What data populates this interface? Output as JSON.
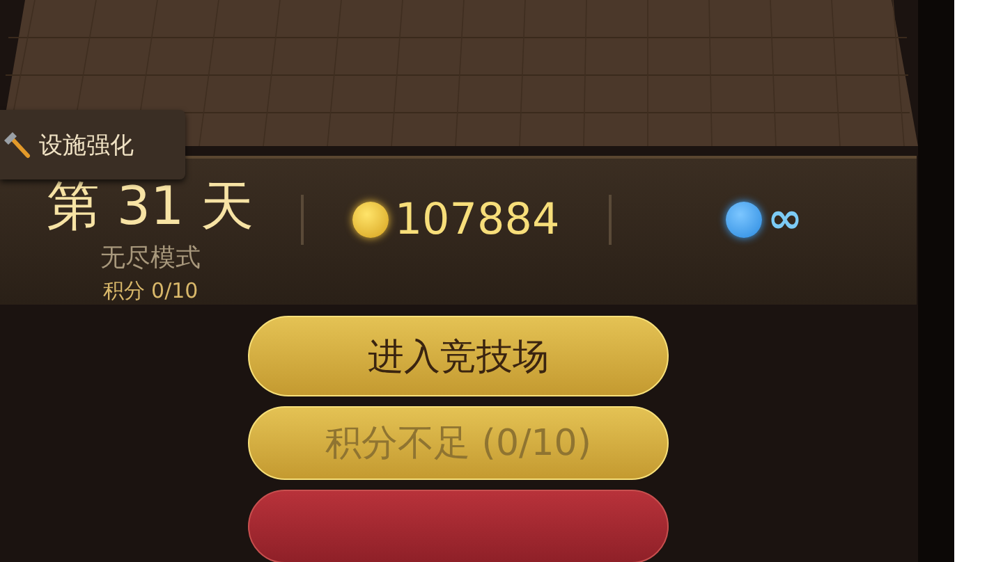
{
  "facility_tab": {
    "label": "设施强化"
  },
  "status_panel": {
    "day": "第 31 天",
    "mode": "无尽模式",
    "score": "积分 0/10",
    "coins": "107884",
    "gems": "∞"
  },
  "buttons": [
    {
      "kind": "gold",
      "label": "进入竞技场",
      "disabled": false
    },
    {
      "kind": "gold",
      "label": "积分不足 (0/10)",
      "disabled": true
    },
    {
      "kind": "red",
      "disabled": false
    }
  ]
}
